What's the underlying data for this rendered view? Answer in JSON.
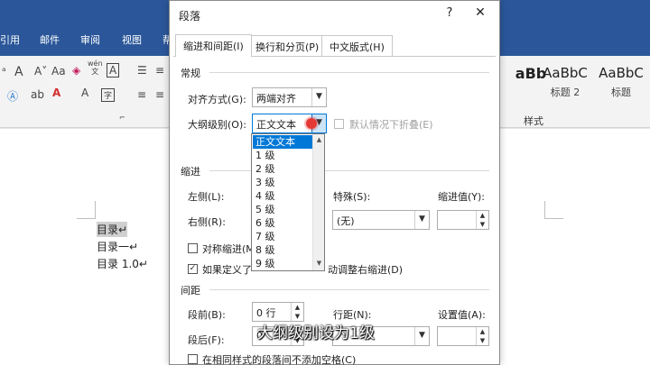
{
  "ribbon": {
    "tabs": [
      "引用",
      "邮件",
      "审阅",
      "视图",
      "帮"
    ],
    "wen_label": "wén\n文",
    "paragraph_group_marker": "⌐",
    "styles_group_label": "样式",
    "styles": [
      {
        "sample": "aBb",
        "name": ""
      },
      {
        "sample": "AaBbC",
        "name": "标题 2"
      },
      {
        "sample": "AaBbC",
        "name": "标题"
      }
    ]
  },
  "document": {
    "lines": [
      "目录↵",
      "目录一↵",
      "目录 1.0↵"
    ]
  },
  "dialog": {
    "title": "段落",
    "help": "?",
    "close": "✕",
    "tabs": [
      "缩进和间距(I)",
      "换行和分页(P)",
      "中文版式(H)"
    ],
    "general": {
      "section": "常规",
      "alignment_label": "对齐方式(G):",
      "alignment_value": "两端对齐",
      "outline_label": "大纲级别(O):",
      "outline_value": "正文文本",
      "collapse_label": "默认情况下折叠(E)"
    },
    "outline_options": [
      "正文文本",
      "1 级",
      "2 级",
      "3 级",
      "4 级",
      "5 级",
      "6 级",
      "7 级",
      "8 级",
      "9 级"
    ],
    "indent": {
      "section": "缩进",
      "left_label": "左侧(L):",
      "right_label": "右侧(R):",
      "special_label": "特殊(S):",
      "special_value": "(无)",
      "indent_value_label": "缩进值(Y):",
      "symmetric_label": "对称缩进(M",
      "grid_label_a": "如果定义了",
      "grid_label_b": "动调整右缩进(D)"
    },
    "spacing": {
      "section": "间距",
      "before_label": "段前(B):",
      "before_value": "0 行",
      "after_label": "段后(F):",
      "after_value": "0",
      "line_label": "行距(N):",
      "setting_label": "设置值(A):",
      "same_style_label": "在相同样式的段落间不添加空格(C)"
    }
  },
  "caption": "大纲级别设为1级"
}
